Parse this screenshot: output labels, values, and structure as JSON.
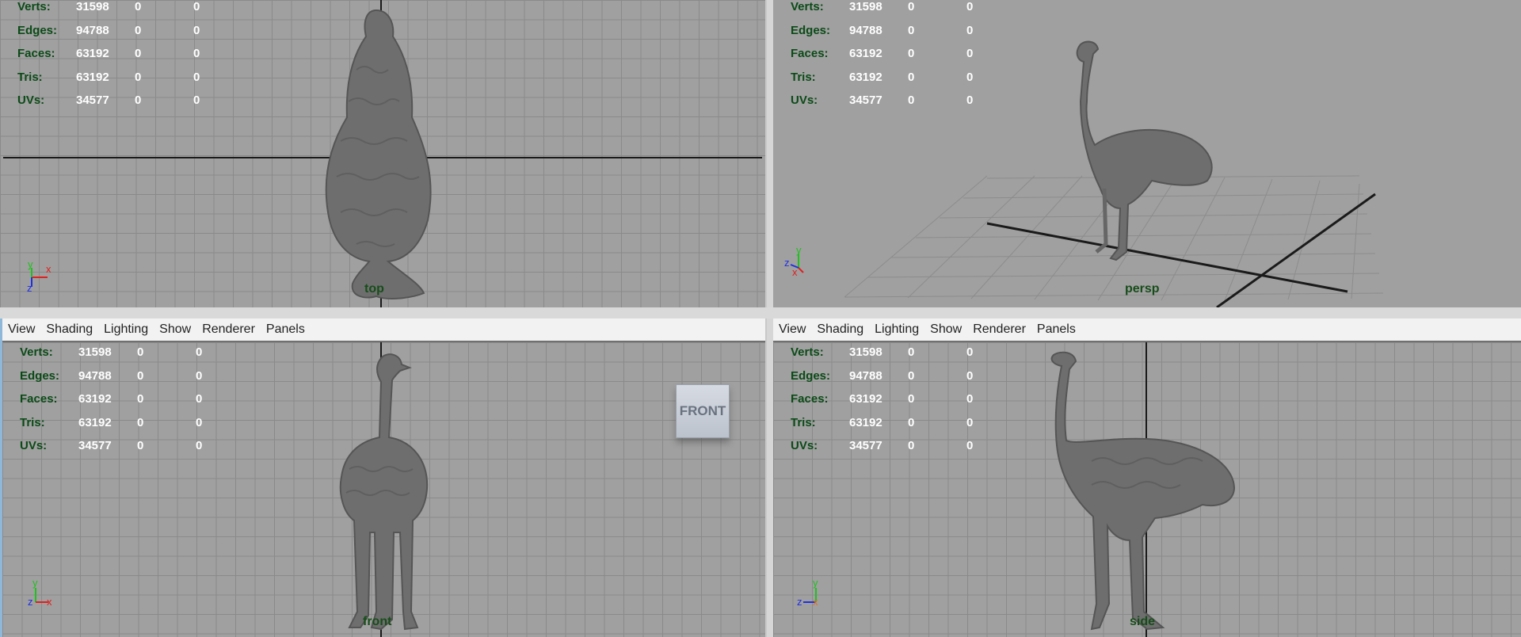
{
  "menus": [
    "View",
    "Shading",
    "Lighting",
    "Show",
    "Renderer",
    "Panels"
  ],
  "hud": {
    "rows": [
      {
        "label": "Verts:",
        "v1": "31598",
        "v2": "0",
        "v3": "0"
      },
      {
        "label": "Edges:",
        "v1": "94788",
        "v2": "0",
        "v3": "0"
      },
      {
        "label": "Faces:",
        "v1": "63192",
        "v2": "0",
        "v3": "0"
      },
      {
        "label": "Tris:",
        "v1": "63192",
        "v2": "0",
        "v3": "0"
      },
      {
        "label": "UVs:",
        "v1": "34577",
        "v2": "0",
        "v3": "0"
      }
    ]
  },
  "viewports": {
    "top": {
      "camera": "top"
    },
    "persp": {
      "camera": "persp"
    },
    "front": {
      "camera": "front",
      "viewcube": "FRONT"
    },
    "side": {
      "camera": "side"
    }
  },
  "axes": {
    "x": "x",
    "y": "y",
    "z": "z"
  },
  "colors": {
    "viewport_bg": "#a0a0a0",
    "grid": "#8a8a8a",
    "hud_label": "#0b4a17",
    "hud_value": "#ffffff",
    "axis_x": "#e02020",
    "axis_y": "#20c020",
    "axis_z": "#2030e0"
  }
}
